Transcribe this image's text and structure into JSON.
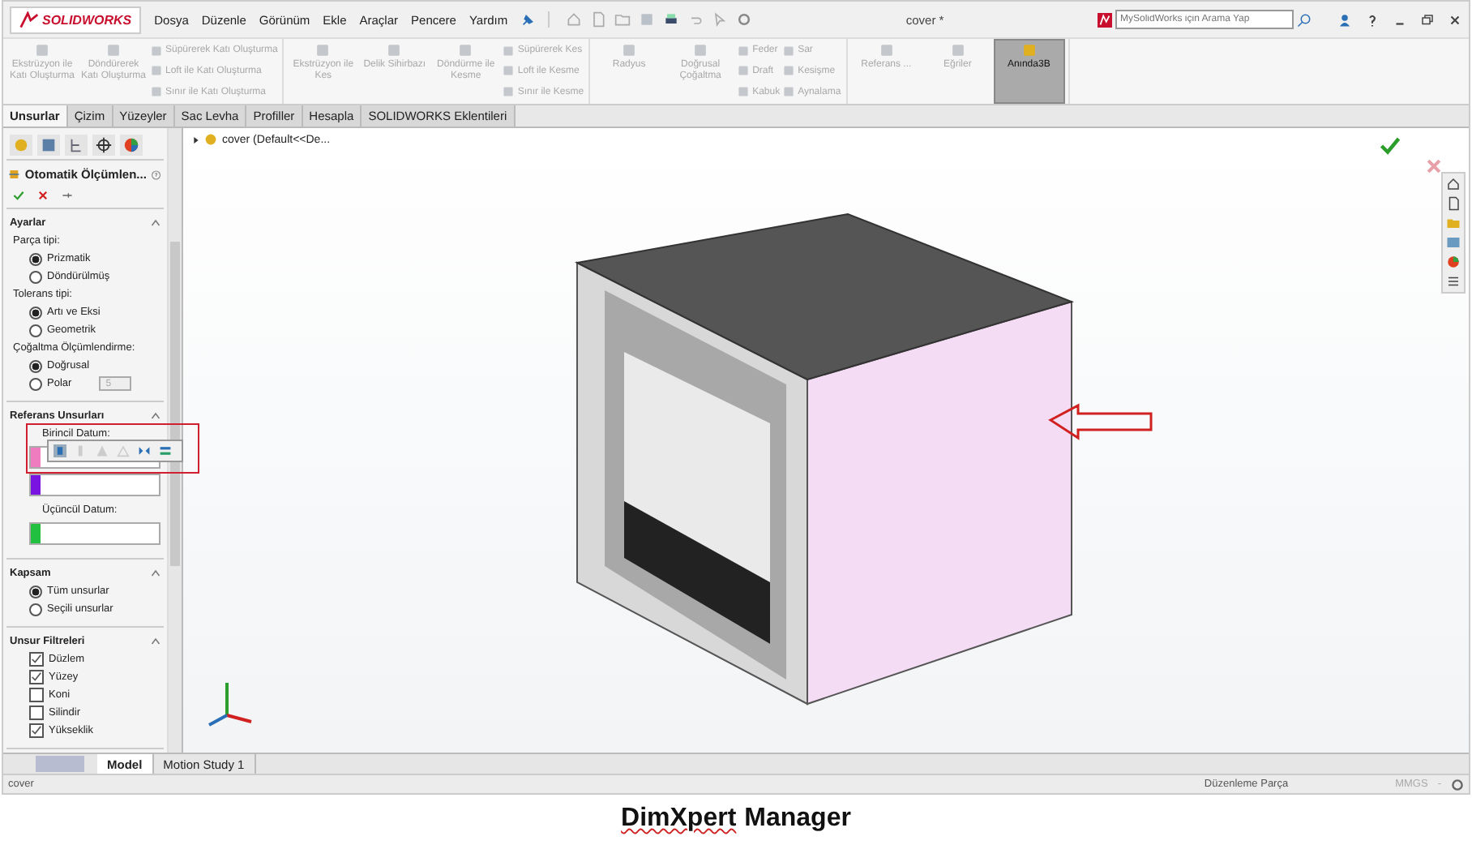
{
  "title_bar": {
    "logo": "SOLIDWORKS",
    "menu": [
      "Dosya",
      "Düzenle",
      "Görünüm",
      "Ekle",
      "Araçlar",
      "Pencere",
      "Yardım"
    ],
    "document_title": "cover *",
    "search": {
      "placeholder": "MySolidWorks için Arama Yap"
    }
  },
  "ribbon": {
    "groups": [
      {
        "columns": [
          [
            {
              "label": "Ekstrüzyon ile Katı Oluşturma",
              "disabled": true,
              "selected": false
            }
          ],
          [
            {
              "label": "Döndürerek Katı Oluşturma",
              "disabled": true,
              "selected": false
            }
          ],
          [
            {
              "label": "Süpürerek Katı Oluşturma",
              "disabled": true,
              "selected": false
            },
            {
              "label": "Loft ile Katı Oluşturma",
              "disabled": true,
              "selected": false
            },
            {
              "label": "Sınır ile Katı Oluşturma",
              "disabled": true,
              "selected": false
            }
          ]
        ]
      },
      {
        "columns": [
          [
            {
              "label": "Ekstrüzyon ile Kes",
              "disabled": true,
              "selected": false
            }
          ],
          [
            {
              "label": "Delik Sihirbazı",
              "disabled": true,
              "selected": false
            }
          ],
          [
            {
              "label": "Döndürme ile Kesme",
              "disabled": true,
              "selected": false
            }
          ],
          [
            {
              "label": "Süpürerek Kes",
              "disabled": true,
              "selected": false
            },
            {
              "label": "Loft ile Kesme",
              "disabled": true,
              "selected": false
            },
            {
              "label": "Sınır ile Kesme",
              "disabled": true,
              "selected": false
            }
          ]
        ]
      },
      {
        "columns": [
          [
            {
              "label": "Radyus",
              "disabled": true,
              "selected": false
            }
          ],
          [
            {
              "label": "Doğrusal Çoğaltma",
              "disabled": true,
              "selected": false
            }
          ],
          [
            {
              "label": "Feder",
              "disabled": true,
              "selected": false
            },
            {
              "label": "Draft",
              "disabled": true,
              "selected": false
            },
            {
              "label": "Kabuk",
              "disabled": true,
              "selected": false
            }
          ],
          [
            {
              "label": "Sar",
              "disabled": true,
              "selected": false
            },
            {
              "label": "Kesişme",
              "disabled": true,
              "selected": false
            },
            {
              "label": "Aynalama",
              "disabled": true,
              "selected": false
            }
          ]
        ]
      },
      {
        "columns": [
          [
            {
              "label": "Referans ...",
              "disabled": true,
              "selected": false
            }
          ],
          [
            {
              "label": "Eğriler",
              "disabled": true,
              "selected": false
            }
          ],
          [
            {
              "label": "Anında3B",
              "disabled": false,
              "selected": true
            }
          ]
        ]
      }
    ]
  },
  "command_tabs": [
    {
      "label": "Unsurlar",
      "selected": true
    },
    {
      "label": "Çizim",
      "selected": false
    },
    {
      "label": "Yüzeyler",
      "selected": false
    },
    {
      "label": "Sac Levha",
      "selected": false
    },
    {
      "label": "Profiller",
      "selected": false
    },
    {
      "label": "Hesapla",
      "selected": false
    },
    {
      "label": "SOLIDWORKS Eklentileri",
      "selected": false
    }
  ],
  "property_manager": {
    "title": "Otomatik Ölçümlen...",
    "sections": [
      {
        "title": "Ayarlar",
        "expanded": true,
        "rows": [
          {
            "kind": "label",
            "text": "Parça tipi:"
          },
          {
            "kind": "radio",
            "text": "Prizmatik",
            "selected": true
          },
          {
            "kind": "radio",
            "text": "Döndürülmüş",
            "selected": false
          },
          {
            "kind": "label",
            "text": "Tolerans tipi:"
          },
          {
            "kind": "radio",
            "text": "Artı ve Eksi",
            "selected": true
          },
          {
            "kind": "radio",
            "text": "Geometrik",
            "selected": false
          },
          {
            "kind": "label",
            "text": "Çoğaltma Ölçümlendirme:"
          },
          {
            "kind": "radio",
            "text": "Doğrusal",
            "selected": true
          },
          {
            "kind": "spinner",
            "text": "Polar",
            "selected": false,
            "value": "5",
            "disabled": true
          }
        ]
      },
      {
        "title": "Referans Unsurları",
        "expanded": true,
        "rows": [
          {
            "kind": "label",
            "text": "Birincil Datum:"
          },
          {
            "kind": "datum",
            "color": "#f07cc0"
          },
          {
            "kind": "datum",
            "color": "#7a14e0"
          },
          {
            "kind": "label",
            "text": "Üçüncül Datum:"
          },
          {
            "kind": "datum",
            "color": "#22c040"
          }
        ]
      },
      {
        "title": "Kapsam",
        "expanded": true,
        "rows": [
          {
            "kind": "radio",
            "text": "Tüm unsurlar",
            "selected": true
          },
          {
            "kind": "radio",
            "text": "Seçili unsurlar",
            "selected": false
          }
        ]
      },
      {
        "title": "Unsur Filtreleri",
        "expanded": true,
        "rows": [
          {
            "kind": "checkbox",
            "text": "Düzlem",
            "checked": true
          },
          {
            "kind": "checkbox",
            "text": "Yüzey",
            "checked": true
          },
          {
            "kind": "checkbox",
            "text": "Koni",
            "checked": false
          },
          {
            "kind": "checkbox",
            "text": "Silindir",
            "checked": false
          },
          {
            "kind": "checkbox",
            "text": "Yükseklik",
            "checked": true
          }
        ]
      }
    ]
  },
  "feature_tree": {
    "root": "cover  (Default<<De..."
  },
  "bottom_tabs": [
    {
      "label": "Model",
      "selected": true
    },
    {
      "label": "Motion Study 1",
      "selected": false
    }
  ],
  "status_bar": {
    "document": "cover",
    "mode": "Düzenleme Parça",
    "units": "MMGS",
    "units_caret": "-"
  },
  "caption": {
    "words": [
      {
        "text": "DimXpert",
        "spellcheck_flag": true
      },
      {
        "text": "Manager",
        "spellcheck_flag": false
      }
    ]
  }
}
